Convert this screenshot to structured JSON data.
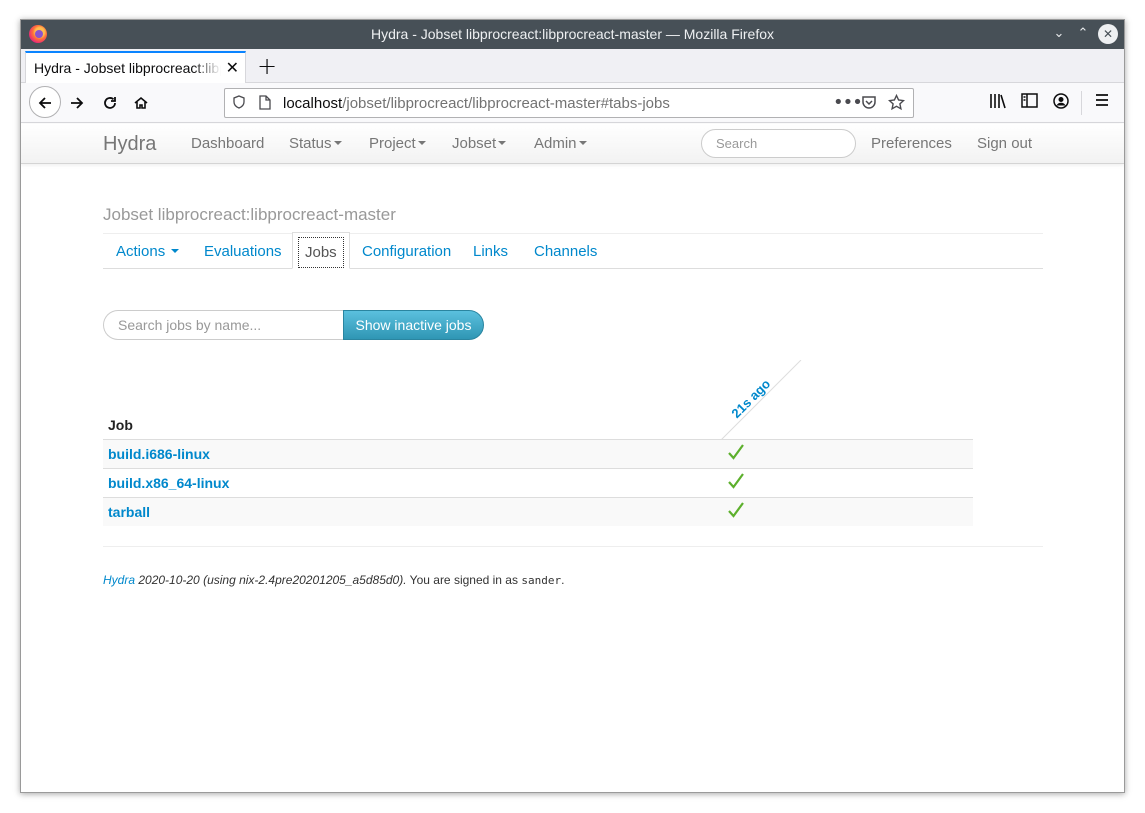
{
  "window": {
    "title": "Hydra - Jobset libprocreact:libprocreact-master — Mozilla Firefox",
    "minimize_glyph": "⌄",
    "maximize_glyph": "⌃",
    "close_glyph": "✕"
  },
  "browser": {
    "tab_title": "Hydra - Jobset libprocreact:libprocreact-master",
    "tab_close": "✕",
    "new_tab": "+",
    "url_host": "localhost",
    "url_path": "/jobset/libprocreact/libprocreact-master#tabs-jobs",
    "icons": {
      "back": "back-arrow-icon",
      "forward": "forward-arrow-icon",
      "reload": "reload-icon",
      "home": "home-icon",
      "shield": "tracking-shield-icon",
      "page": "page-icon",
      "more": "more-actions-icon",
      "pocket": "pocket-icon",
      "bookmark": "bookmark-star-icon",
      "library": "library-icon",
      "sidebar": "sidebar-icon",
      "account": "account-icon",
      "menu": "hamburger-menu-icon"
    }
  },
  "hydra_nav": {
    "brand": "Hydra",
    "items": [
      {
        "label": "Dashboard",
        "dropdown": false
      },
      {
        "label": "Status",
        "dropdown": true
      },
      {
        "label": "Project",
        "dropdown": true
      },
      {
        "label": "Jobset",
        "dropdown": true
      },
      {
        "label": "Admin",
        "dropdown": true
      }
    ],
    "search_placeholder": "Search",
    "preferences": "Preferences",
    "sign_out": "Sign out"
  },
  "page": {
    "heading": "Jobset libprocreact:libprocreact-master",
    "tabs": [
      {
        "label": "Actions",
        "dropdown": true,
        "active": false
      },
      {
        "label": "Evaluations",
        "active": false
      },
      {
        "label": "Jobs",
        "active": true
      },
      {
        "label": "Configuration",
        "active": false
      },
      {
        "label": "Links",
        "active": false
      },
      {
        "label": "Channels",
        "active": false
      }
    ],
    "filter_placeholder": "Search jobs by name...",
    "show_inactive_label": "Show inactive jobs"
  },
  "jobs_table": {
    "job_header": "Job",
    "eval_header": "21s ago",
    "rows": [
      {
        "name": "build.i686-linux",
        "status": "succeeded"
      },
      {
        "name": "build.x86_64-linux",
        "status": "succeeded"
      },
      {
        "name": "tarball",
        "status": "succeeded"
      }
    ],
    "success_color": "#5db02d"
  },
  "footer": {
    "hydra_link": "Hydra",
    "version_text": " 2020-10-20 (using nix-2.4pre20201205_a5d85d0).",
    "signed_in_text": " You are signed in as ",
    "username": "sander",
    "end": "."
  }
}
